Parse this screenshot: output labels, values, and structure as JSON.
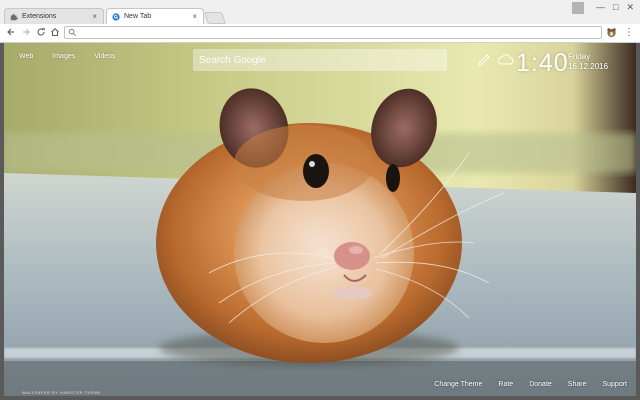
{
  "browser": {
    "tabs": [
      {
        "title": "Extensions",
        "icon": "puzzle-icon"
      },
      {
        "title": "New Tab",
        "icon": "new-tab-icon"
      }
    ],
    "tab_close_glyph": "×",
    "window_controls": [
      "—",
      "□",
      "✕"
    ],
    "omnibox": {
      "value": "",
      "placeholder": ""
    },
    "accent_color": "#1a73e8"
  },
  "newtab": {
    "top_links": [
      "Web",
      "Images",
      "Videos"
    ],
    "search_placeholder": "Search Google",
    "clock": "1:40",
    "day": "Friday",
    "date": "16.12.2016",
    "weather_icon": "cloud-icon",
    "pen_icon": "pen-icon",
    "bottom_links": [
      "Change Theme",
      "Rate",
      "Donate",
      "Share",
      "Support"
    ],
    "watermark": "WALLPAPER BY HAMSTER THEME"
  }
}
